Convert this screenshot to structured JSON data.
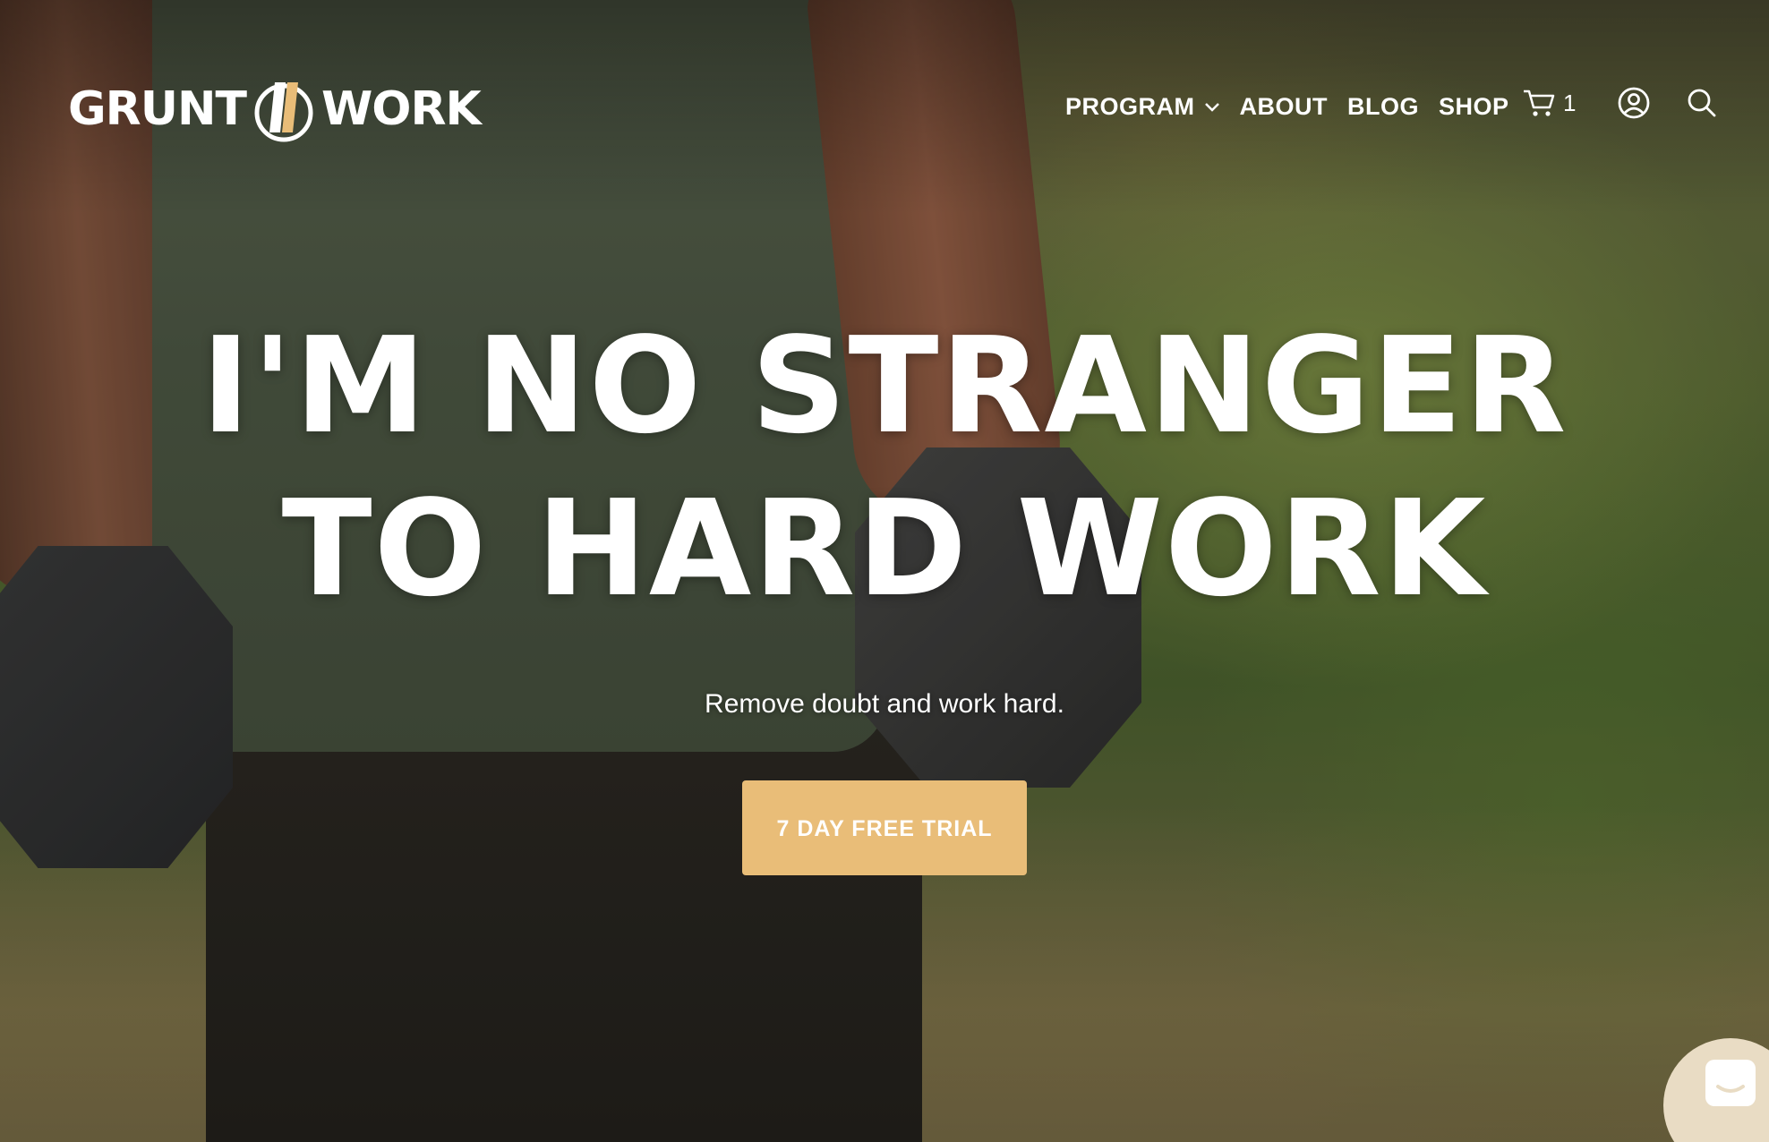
{
  "brand": {
    "logo_left": "GRUNT",
    "logo_right": "WORK",
    "accent_color": "#e9bd78"
  },
  "nav": {
    "items": [
      {
        "label": "PROGRAM",
        "has_dropdown": true
      },
      {
        "label": "ABOUT"
      },
      {
        "label": "BLOG"
      },
      {
        "label": "SHOP"
      }
    ]
  },
  "header_icons": {
    "cart_icon": "cart-icon",
    "cart_count": "1",
    "account_icon": "account-icon",
    "search_icon": "search-icon"
  },
  "hero": {
    "headline_line1": "I'M NO STRANGER",
    "headline_line2": "TO HARD WORK",
    "subheadline": "Remove doubt and work hard.",
    "cta_label": "7 DAY FREE TRIAL"
  },
  "chat": {
    "icon": "chat-icon"
  }
}
